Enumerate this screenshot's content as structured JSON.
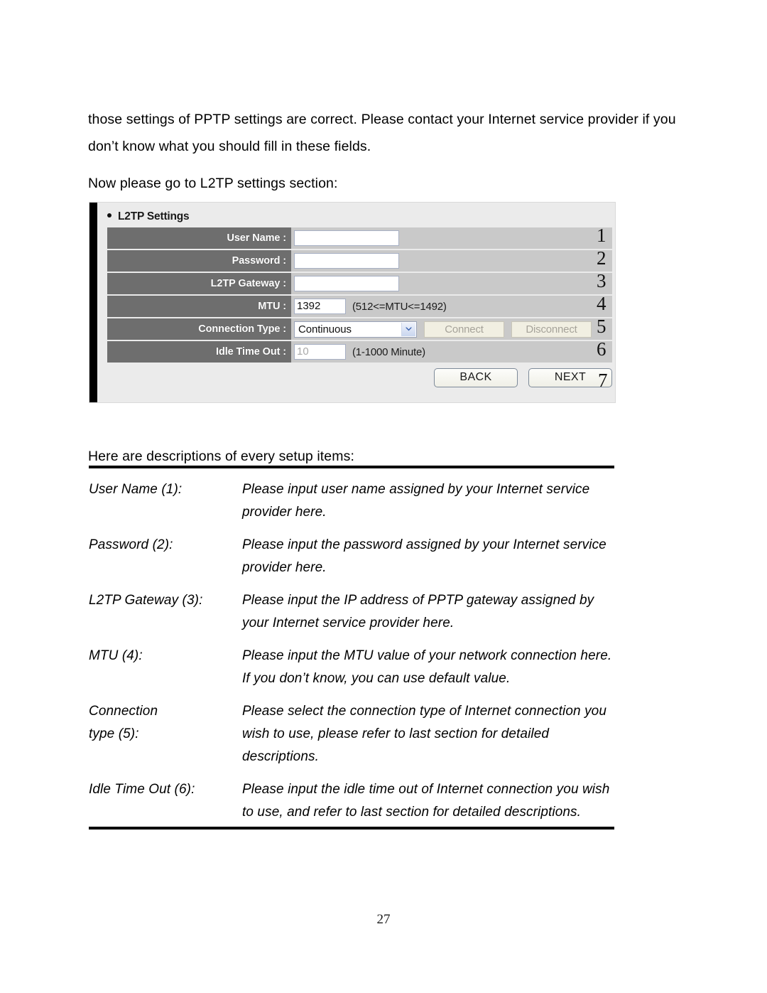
{
  "document": {
    "intro_paragraph": "those settings of PPTP settings are correct. Please contact your Internet service provider if you don’t know what you should fill in these fields.",
    "goto_paragraph": "Now please go to L2TP settings section:",
    "descriptions_lead": "Here are descriptions of every setup items:",
    "page_number": "27"
  },
  "panel": {
    "title": "L2TP Settings",
    "rows": [
      {
        "label": "User Name :",
        "control": "text",
        "value": "",
        "hint": "",
        "number": "1"
      },
      {
        "label": "Password :",
        "control": "text",
        "value": "",
        "hint": "",
        "number": "2"
      },
      {
        "label": "L2TP Gateway :",
        "control": "text",
        "value": "",
        "hint": "",
        "number": "3"
      },
      {
        "label": "MTU :",
        "control": "number",
        "value": "1392",
        "hint": "(512<=MTU<=1492)",
        "number": "4"
      },
      {
        "label": "Connection Type :",
        "control": "select",
        "value": "Continuous",
        "hint": "",
        "number": "5"
      },
      {
        "label": "Idle Time Out :",
        "control": "number",
        "value": "10",
        "hint": "(1-1000 Minute)",
        "number": "6"
      }
    ],
    "connect_button": "Connect",
    "disconnect_button": "Disconnect",
    "back_button": "BACK",
    "next_button": "NEXT",
    "footer_number": "7",
    "colors": {
      "label_bg": "#6e6e6e",
      "row_bg": "#c9c9c9",
      "panel_bg": "#ebebeb",
      "input_border": "#a7b0c4",
      "disabled_button_bg": "#f1efe2",
      "disabled_button_text": "#a6a39a"
    }
  },
  "descriptions": [
    {
      "term": "User Name (1):",
      "text": "Please input user name assigned by your Internet service provider here."
    },
    {
      "term": "Password (2):",
      "text": "Please input the password assigned by your Internet service provider here."
    },
    {
      "term": "L2TP Gateway (3):",
      "text": "Please input the IP address of PPTP gateway assigned by your Internet service provider here."
    },
    {
      "term": "MTU (4):",
      "text": "Please input the MTU value of your network connection here. If you don’t know, you can use default value."
    },
    {
      "term": "Connection\ntype (5):",
      "text": "Please select the connection type of Internet connection you wish to use, please refer to last section for detailed descriptions."
    },
    {
      "term": "Idle Time Out (6):",
      "text": "Please input the idle time out of Internet connection   you wish to use, and refer to last section for detailed descriptions."
    }
  ]
}
